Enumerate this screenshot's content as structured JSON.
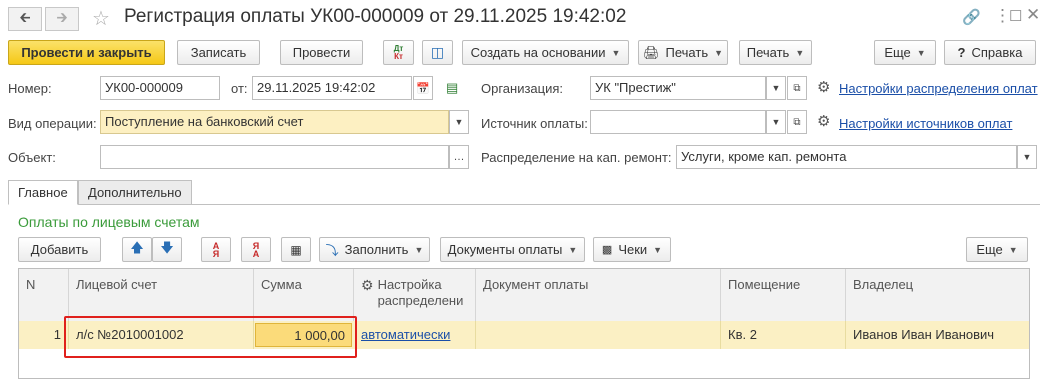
{
  "window": {
    "title": "Регистрация оплаты УК00-000009 от 29.11.2025 19:42:02",
    "back_icon": "arrow-left-icon",
    "forward_icon": "arrow-right-icon",
    "star_icon": "star-icon",
    "link_icon": "link-icon",
    "menu_icon": "more-vertical-icon",
    "maximize_icon": "maximize-icon",
    "close_icon": "close-icon"
  },
  "toolbar": {
    "post_close": "Провести и закрыть",
    "save": "Записать",
    "post": "Провести",
    "dt_kt": "Дт Кт",
    "create_based": "Создать на основании",
    "print_icon_btn": "Печать",
    "print": "Печать",
    "more": "Еще",
    "help": "Справка",
    "help_prefix": "?"
  },
  "form": {
    "number_label": "Номер:",
    "number_value": "УК00-000009",
    "from_label": "от:",
    "date_value": "29.11.2025 19:42:02",
    "org_label": "Организация:",
    "org_value": "УК \"Престиж\"",
    "dist_settings_link": "Настройки распределения оплат",
    "op_label": "Вид операции:",
    "op_value": "Поступление на банковский счет",
    "source_label": "Источник оплаты:",
    "source_value": "",
    "source_settings_link": "Настройки источников оплат",
    "object_label": "Объект:",
    "object_value": "",
    "capital_label": "Распределение на кап. ремонт:",
    "capital_value": "Услуги, кроме кап. ремонта"
  },
  "tabs": [
    {
      "label": "Главное",
      "active": true
    },
    {
      "label": "Дополнительно",
      "active": false
    }
  ],
  "payments": {
    "title": "Оплаты по лицевым счетам",
    "add": "Добавить",
    "fill": "Заполнить",
    "docs": "Документы оплаты",
    "checks": "Чеки",
    "more": "Еще",
    "columns": [
      "N",
      "Лицевой счет",
      "Сумма",
      "Настройка распределени",
      "Документ оплаты",
      "Помещение",
      "Владелец"
    ],
    "rows": [
      {
        "n": "1",
        "account": "л/с №2010001002",
        "sum": "1 000,00",
        "setting": "автоматически",
        "doc": "",
        "room": "Кв. 2",
        "owner": "Иванов Иван Иванович"
      }
    ]
  }
}
